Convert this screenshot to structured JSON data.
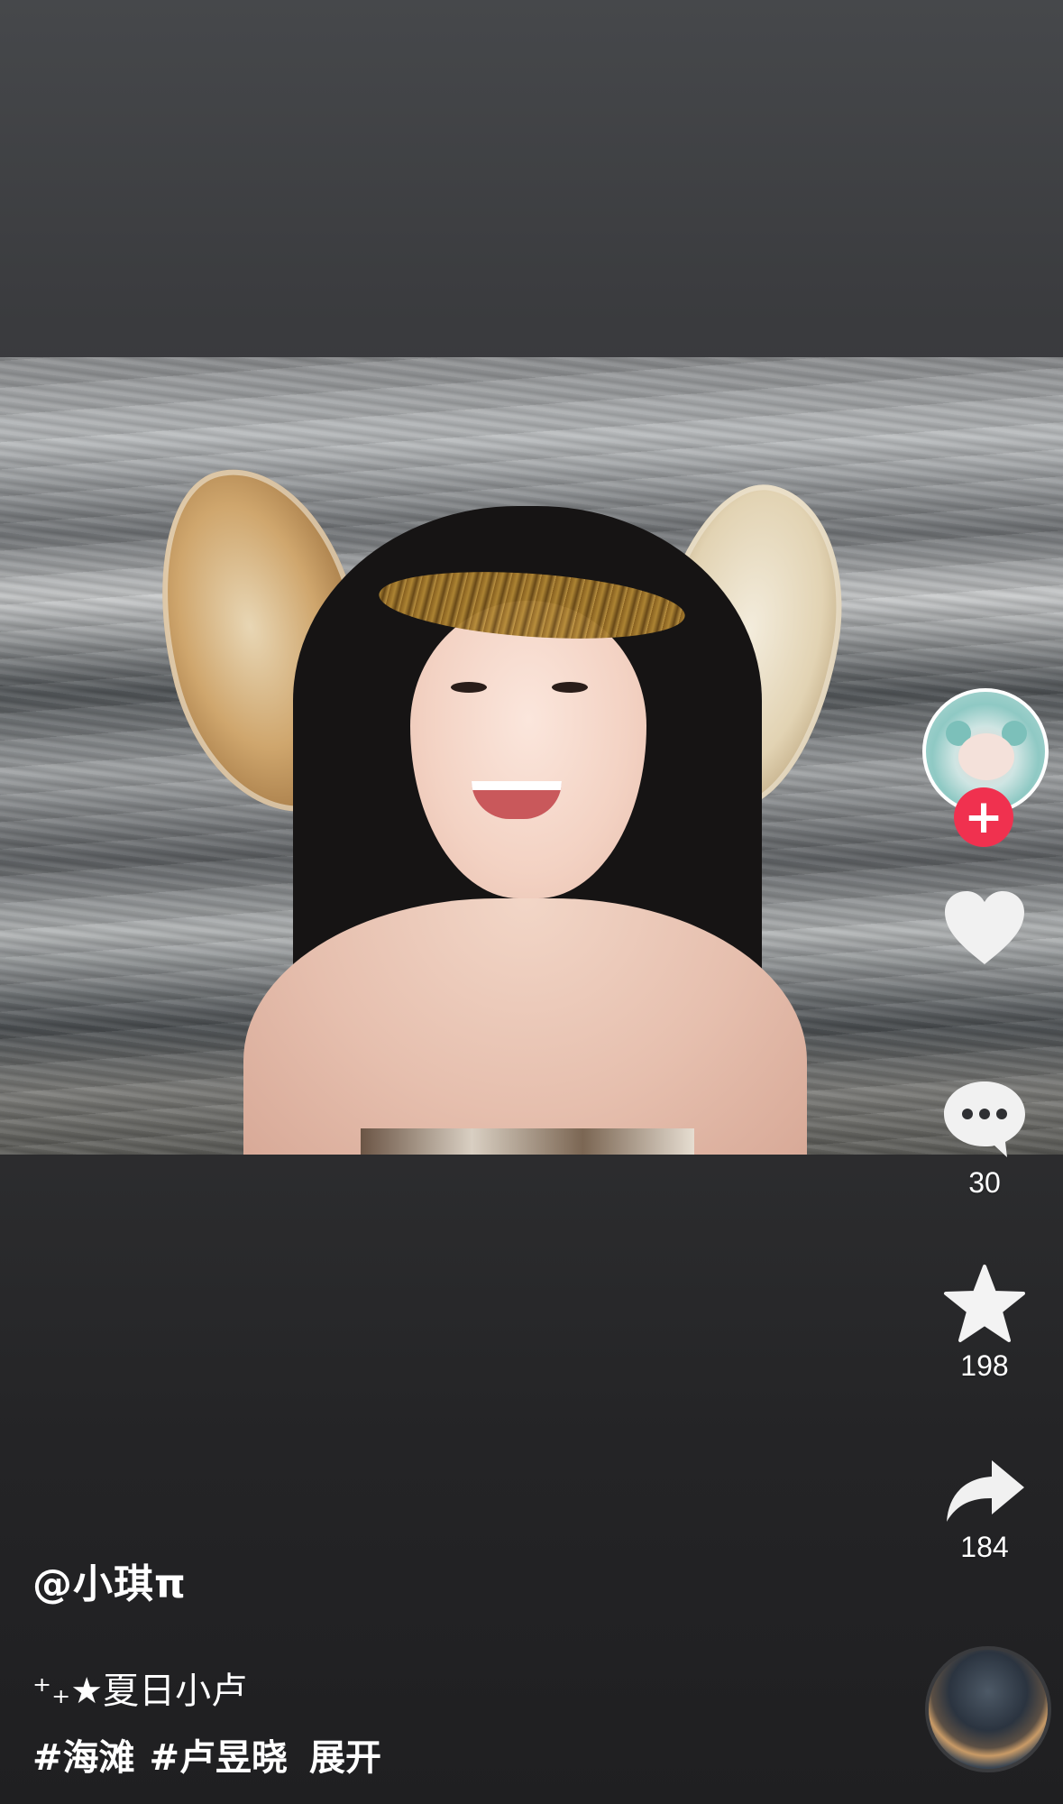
{
  "author": {
    "handle": "@小琪π"
  },
  "post": {
    "description": "⁺₊★夏日小卢",
    "hashtags": [
      "#海滩",
      "#卢昱晓"
    ],
    "expand_label": "展开"
  },
  "actions": {
    "like": {
      "icon": "heart-icon",
      "count": ""
    },
    "comment": {
      "icon": "comment-icon",
      "count": "30"
    },
    "favorite": {
      "icon": "star-icon",
      "count": "198"
    },
    "share": {
      "icon": "share-icon",
      "count": "184"
    }
  },
  "follow": {
    "icon": "plus-icon",
    "symbol": "+"
  },
  "colors": {
    "follow_accent": "#f0314f",
    "icon": "#ffffff",
    "background": "#333436"
  }
}
